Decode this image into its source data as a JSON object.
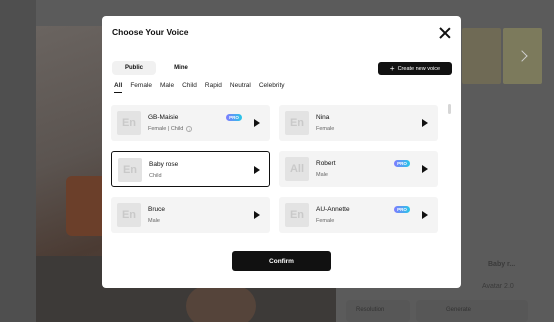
{
  "background": {
    "meta_right": "Baby r...",
    "meta_model": "Avatar 2.0",
    "resolution_label": "Resolution",
    "generate_label": "Generate"
  },
  "dialog": {
    "title": "Choose Your Voice",
    "segments": [
      {
        "label": "Public",
        "active": true
      },
      {
        "label": "Mine",
        "active": false
      }
    ],
    "create_button": "Create new voice",
    "filters": [
      {
        "label": "All",
        "active": true
      },
      {
        "label": "Female"
      },
      {
        "label": "Male"
      },
      {
        "label": "Child"
      },
      {
        "label": "Rapid"
      },
      {
        "label": "Neutral"
      },
      {
        "label": "Celebrity"
      }
    ],
    "voices": [
      {
        "lang": "En",
        "name": "GB-Maisie",
        "sub": "Female | Child",
        "pro": true,
        "info": true,
        "selected": false
      },
      {
        "lang": "En",
        "name": "Nina",
        "sub": "Female",
        "pro": false,
        "selected": false
      },
      {
        "lang": "En",
        "name": "Baby rose",
        "sub": "Child",
        "pro": false,
        "selected": true
      },
      {
        "lang": "All",
        "name": "Robert",
        "sub": "Male",
        "pro": true,
        "selected": false
      },
      {
        "lang": "En",
        "name": "Bruce",
        "sub": "Male",
        "pro": false,
        "selected": false
      },
      {
        "lang": "En",
        "name": "AU-Annette",
        "sub": "Female",
        "pro": true,
        "selected": false
      }
    ],
    "pro_label": "PRO",
    "confirm_button": "Confirm"
  },
  "colors": {
    "overlay": "#5b5b5b",
    "primary": "#111111",
    "card_bg": "#f4f4f4",
    "pro_gradient_start": "#7f7bff",
    "pro_gradient_end": "#27c7e6"
  }
}
